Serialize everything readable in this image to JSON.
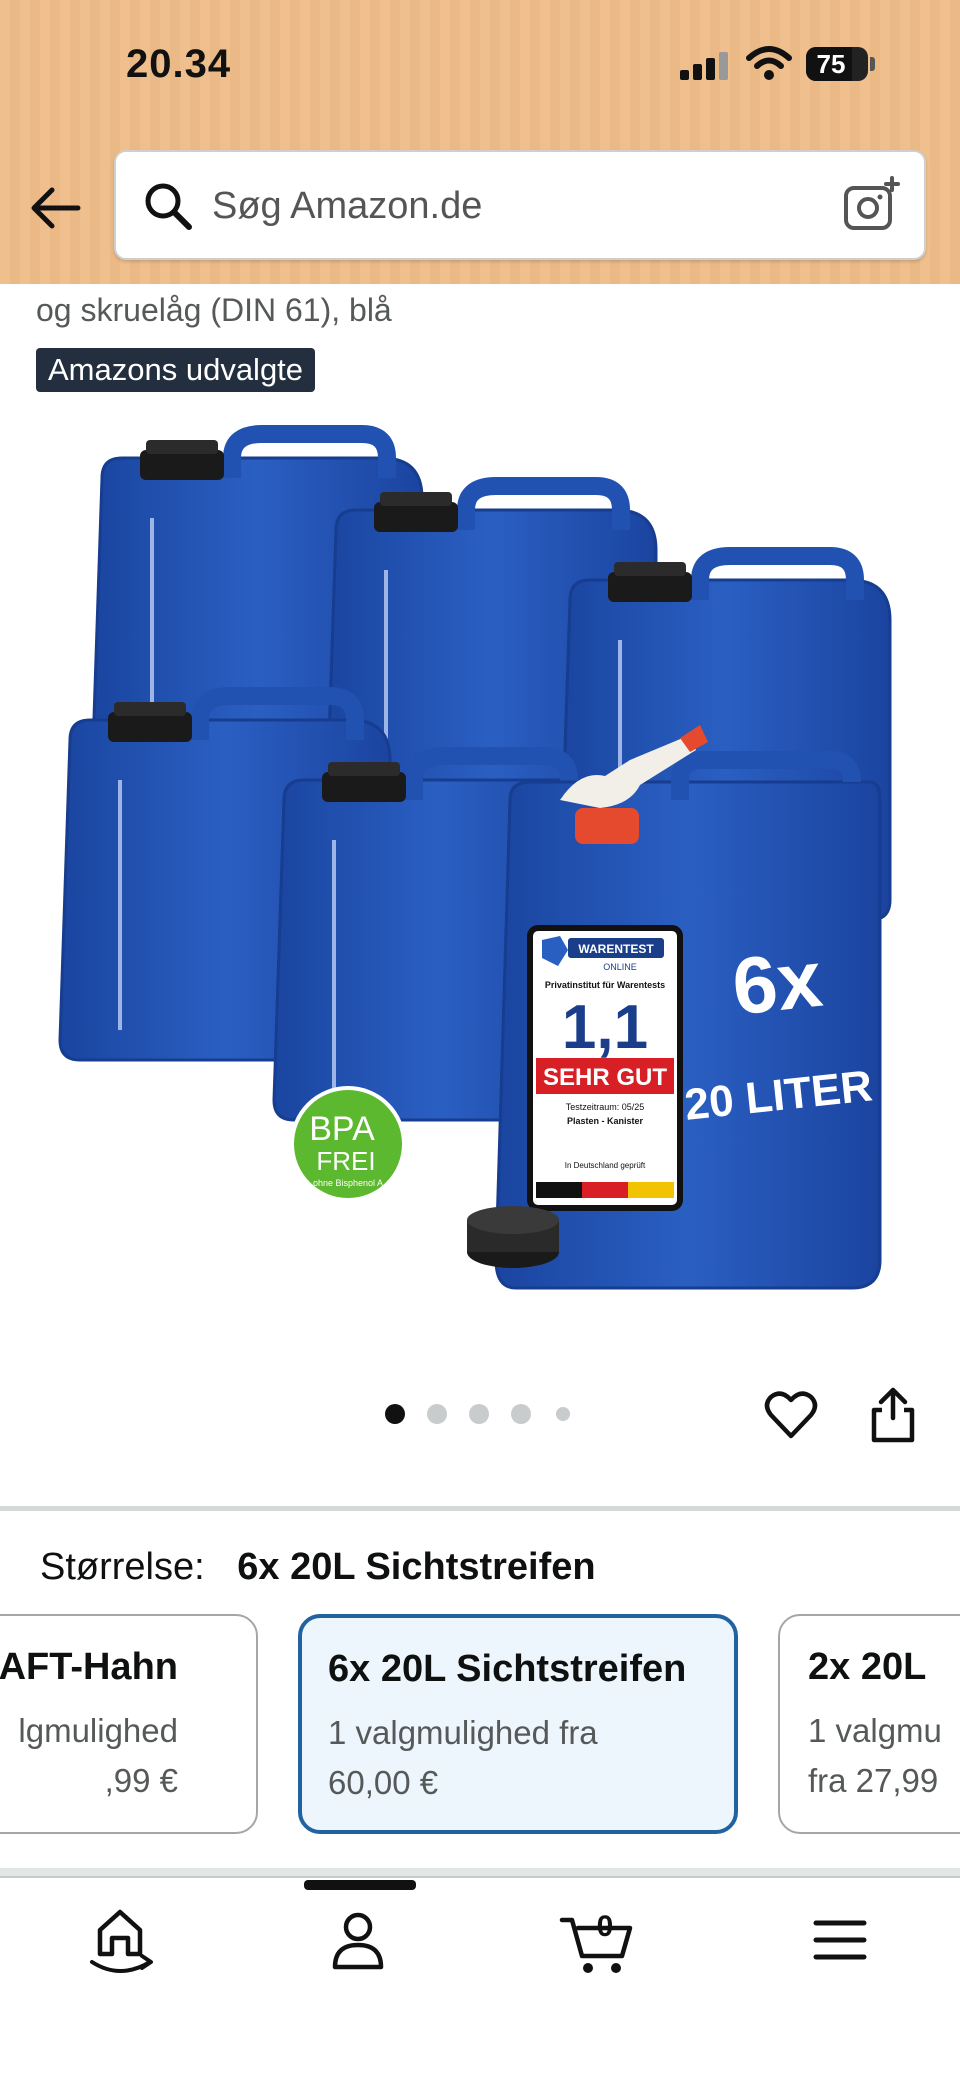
{
  "status_bar": {
    "time": "20.34",
    "battery": "75"
  },
  "search": {
    "placeholder": "Søg Amazon.de"
  },
  "product": {
    "title_tail": "og skruelåg (DIN 61), blå",
    "badge": "Amazons udvalgte",
    "image_alt": "6x 20 liter blue canisters",
    "image_labels": {
      "pack": "6x",
      "volume": "20 LITER",
      "bpa_line1": "BPA",
      "bpa_line2": "FREI",
      "bpa_sub": "ohne Bisphenol A",
      "test_brand": "WARENTEST",
      "test_brand_sub": "ONLINE",
      "test_institute": "Privatinstitut für Warentests",
      "test_grade": "1,1",
      "test_verdict": "SEHR GUT",
      "test_period": "Testzeitraum: 05/25",
      "test_product": "Plasten - Kanister",
      "test_country": "In Deutschland geprüft"
    },
    "gallery": {
      "count": 5,
      "active_index": 0
    }
  },
  "size_selector": {
    "label": "Størrelse:",
    "selected": "6x 20L Sichtstreifen",
    "options": [
      {
        "name": "AFT-Hahn",
        "sub": "lgmulighed",
        "price": ",99 €"
      },
      {
        "name": "6x 20L Sichtstreifen",
        "sub": "1 valgmulighed fra",
        "price": "60,00 €"
      },
      {
        "name": "2x 20L",
        "sub": "1 valgmu",
        "price": "fra 27,99"
      }
    ]
  },
  "bottom_nav": {
    "items": [
      {
        "icon": "home-icon",
        "label": "Home"
      },
      {
        "icon": "account-icon",
        "label": "Account"
      },
      {
        "icon": "cart-icon",
        "label": "Cart"
      },
      {
        "icon": "menu-icon",
        "label": "Menu"
      }
    ],
    "cart_count": "0"
  },
  "colors": {
    "header_bg": "#efc08e",
    "selected_border": "#2162a1",
    "selected_bg": "#edf6fc",
    "canister_blue": "#1f4fae",
    "badge_bg": "#232f3e"
  }
}
